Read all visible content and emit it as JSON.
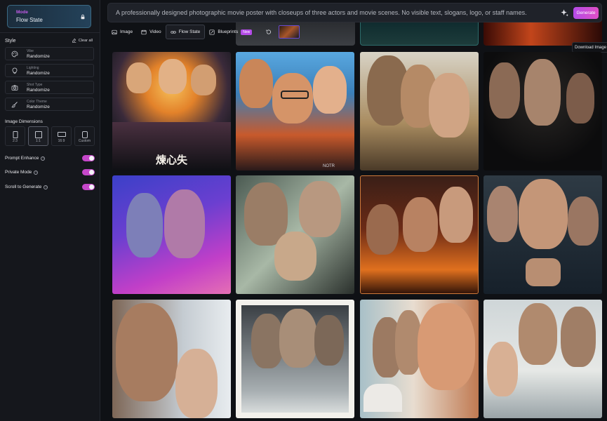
{
  "sidebar": {
    "mode": {
      "label": "Mode",
      "value": "Flow State",
      "lock_icon": "lock-icon"
    },
    "style_heading": "Style",
    "clear_all": "Clear all",
    "options": [
      {
        "title": "Vibe",
        "value": "Randomize",
        "icon": "palette-icon"
      },
      {
        "title": "Lighting",
        "value": "Randomize",
        "icon": "lightbulb-icon"
      },
      {
        "title": "Shot Type",
        "value": "Randomize",
        "icon": "camera-icon"
      },
      {
        "title": "Color Theme",
        "value": "Randomize",
        "icon": "brush-icon"
      }
    ],
    "dimensions_heading": "Image Dimensions",
    "dimensions": [
      {
        "label": "2:3",
        "selected": false
      },
      {
        "label": "1:1",
        "selected": true
      },
      {
        "label": "16:9",
        "selected": false
      },
      {
        "label": "Custom",
        "selected": false
      }
    ],
    "toggles": [
      {
        "label": "Prompt Enhance",
        "on": true
      },
      {
        "label": "Private Mode",
        "on": true
      },
      {
        "label": "Scroll to Generate",
        "on": true
      }
    ]
  },
  "prompt": {
    "text": "A professionally designed photographic movie poster with closeups of three actors and movie scenes. No visible text, slogans, logo, or staff names.",
    "generate_label": "Generate"
  },
  "toolbar": {
    "image": "Image",
    "video": "Video",
    "flow_state": "Flow State",
    "blueprints": "Blueprints",
    "new_badge": "New"
  },
  "tooltip": "Download Image",
  "gallery": {
    "poster_text": "煉心失",
    "small_mark": "NOTR"
  }
}
